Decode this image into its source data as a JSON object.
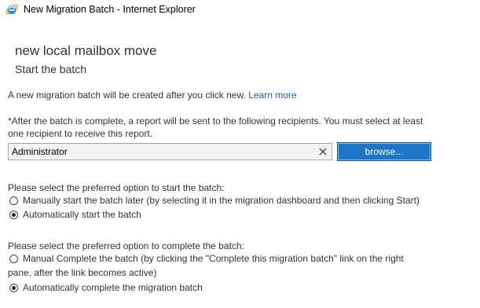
{
  "window": {
    "title": "New Migration Batch - Internet Explorer",
    "icon": "internet-explorer-icon"
  },
  "page": {
    "heading": "new local mailbox move",
    "subheading": "Start the batch"
  },
  "intro": {
    "text": "A new migration batch will be created after you click new.",
    "link": "Learn more"
  },
  "recipients": {
    "note_line1": "*After the batch is complete, a report will be sent to the following recipients. You must select at least",
    "note_line2": "one recipient to receive this report.",
    "value": "Administrator",
    "clear_icon": "close-icon",
    "browse_label": "browse..."
  },
  "start_options": {
    "prompt": "Please select the preferred option to start the batch:",
    "options": [
      {
        "label": "Manually start the batch later (by selecting it in the migration dashboard and then clicking Start)",
        "selected": false
      },
      {
        "label": "Automatically start the batch",
        "selected": true
      }
    ]
  },
  "complete_options": {
    "prompt": "Please select the preferred option to complete the batch:",
    "option1_line1": "Manual Complete the batch (by clicking the \"Complete this migration batch\" link on the right",
    "option1_line2": "pane, after the link becomes active)",
    "option1_selected": false,
    "option2": "Automatically complete the migration batch",
    "option2_selected": true
  },
  "colors": {
    "accent": "#1f74c8",
    "link": "#1a5fb4",
    "text": "#333333"
  }
}
